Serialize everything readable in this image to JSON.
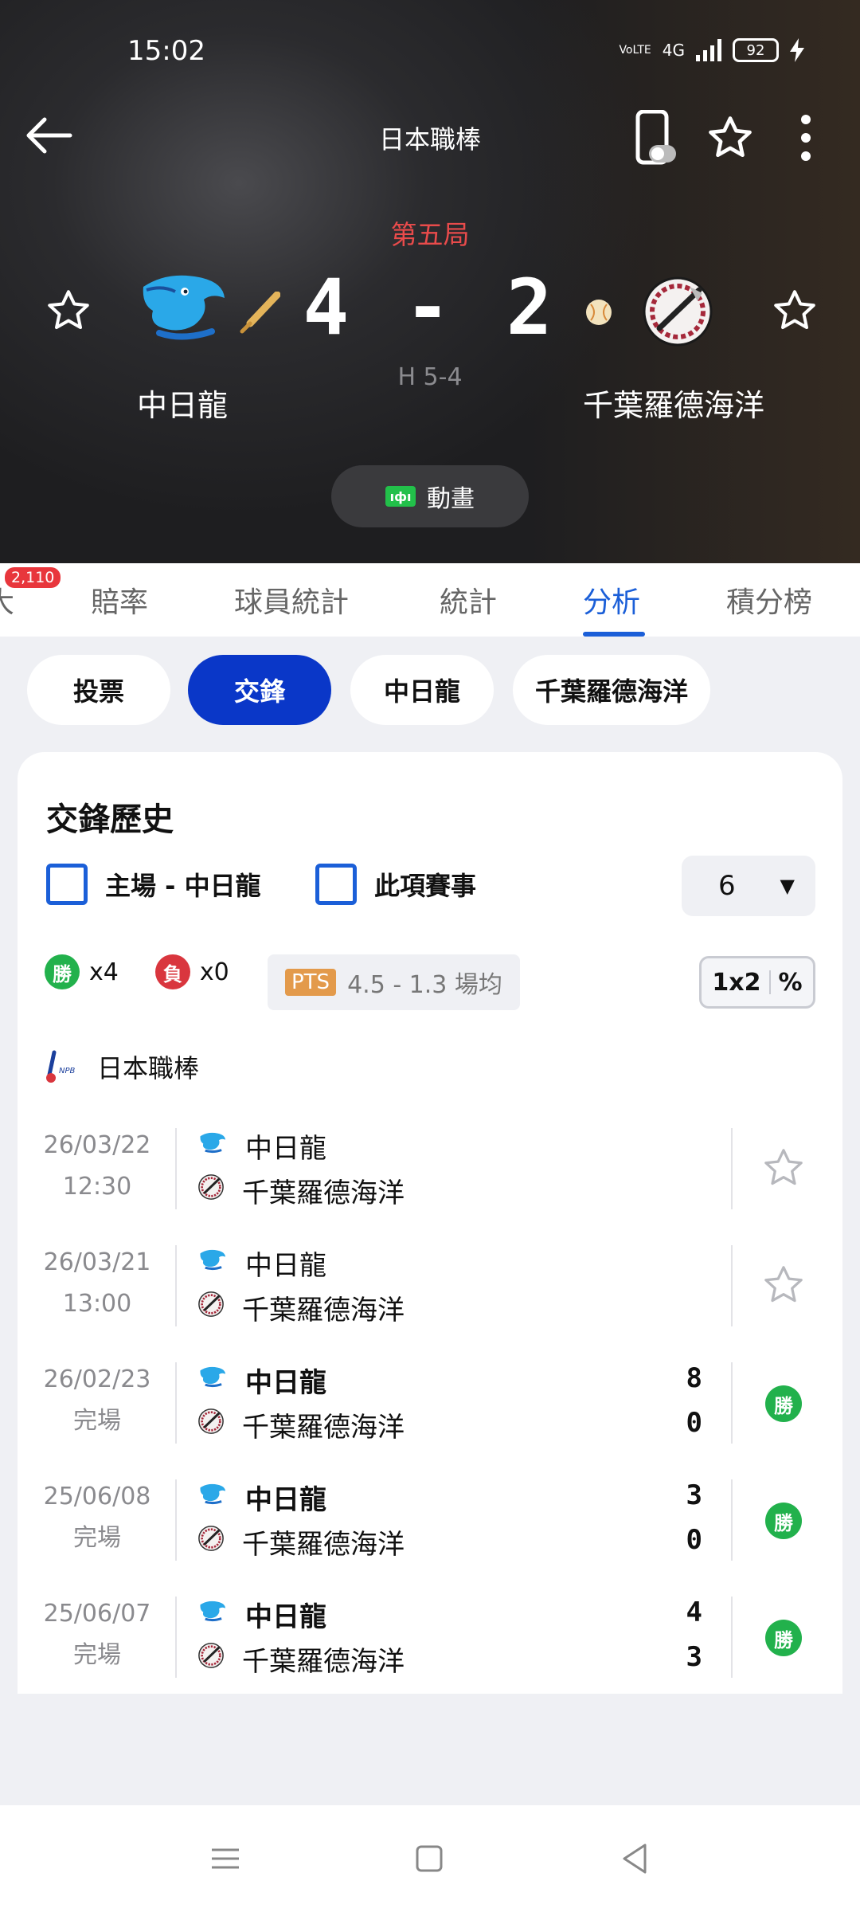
{
  "status_bar": {
    "time": "15:02",
    "network": "4G",
    "volte": "VoLTE",
    "battery": "92"
  },
  "header": {
    "league": "日本職棒",
    "inning": "第五局",
    "score": "4 - 2",
    "hits": "H 5-4",
    "home_team": "中日龍",
    "away_team": "千葉羅德海洋",
    "animation_label": "動畫",
    "animation_icon_text": "ıфı"
  },
  "tabs": {
    "badge": "2,110",
    "items": [
      "大",
      "賠率",
      "球員統計",
      "統計",
      "分析",
      "積分榜"
    ],
    "active": "分析"
  },
  "filters": [
    "投票",
    "交鋒",
    "中日龍",
    "千葉羅德海洋"
  ],
  "h2h": {
    "title": "交鋒歷史",
    "check_home": "主場 - 中日龍",
    "check_event": "此項賽事",
    "count_value": "6",
    "count_arrow": "▼",
    "win_icon": "勝",
    "win_count": "x4",
    "loss_icon": "負",
    "loss_count": "x0",
    "pts_tag": "PTS",
    "pts_text": "4.5 - 1.3 場均",
    "odds_a": "1x2",
    "odds_b": "%",
    "league": "日本職棒",
    "matches": [
      {
        "date": "26/03/22",
        "time": "12:30",
        "home": "中日龍",
        "away": "千葉羅德海洋",
        "home_score": "",
        "away_score": "",
        "result": ""
      },
      {
        "date": "26/03/21",
        "time": "13:00",
        "home": "中日龍",
        "away": "千葉羅德海洋",
        "home_score": "",
        "away_score": "",
        "result": ""
      },
      {
        "date": "26/02/23",
        "time": "完場",
        "home": "中日龍",
        "away": "千葉羅德海洋",
        "home_score": "8",
        "away_score": "0",
        "result": "勝"
      },
      {
        "date": "25/06/08",
        "time": "完場",
        "home": "中日龍",
        "away": "千葉羅德海洋",
        "home_score": "3",
        "away_score": "0",
        "result": "勝"
      },
      {
        "date": "25/06/07",
        "time": "完場",
        "home": "中日龍",
        "away": "千葉羅德海洋",
        "home_score": "4",
        "away_score": "3",
        "result": "勝"
      }
    ]
  },
  "colors": {
    "accent": "#1b5fd8",
    "chip_active": "#0a37c8",
    "win": "#22b14c",
    "loss": "#d9363e",
    "inning": "#e94b4b"
  }
}
